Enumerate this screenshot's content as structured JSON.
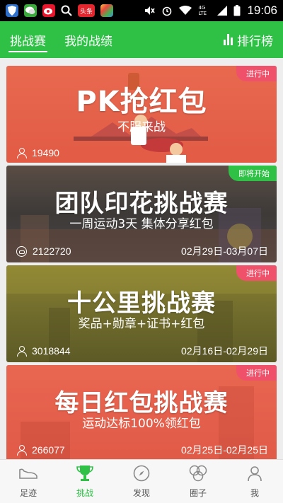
{
  "status_bar": {
    "time": "19:06",
    "network_label": "4G LTE",
    "notif_app_label": "头条",
    "icons": [
      "shield-app-icon",
      "wechat-icon",
      "weibo-icon",
      "search-icon",
      "toutiao-icon",
      "photos-icon",
      "mute-icon",
      "alarm-icon",
      "wifi-icon",
      "signal-icon",
      "battery-icon"
    ]
  },
  "header": {
    "tabs": [
      {
        "label": "挑战赛",
        "active": true
      },
      {
        "label": "我的战绩",
        "active": false
      }
    ],
    "rank_label": "排行榜",
    "accent_color": "#2ec146"
  },
  "cards": [
    {
      "title": "PK抢红包",
      "subtitle": "不服来战",
      "badge": "进行中",
      "count": "19490",
      "dates": "",
      "count_icon": "person-icon"
    },
    {
      "title": "团队印花挑战赛",
      "subtitle": "一周运动3天 集体分享红包",
      "badge": "即将开始",
      "count": "2122720",
      "dates": "02月29日-03月07日",
      "count_icon": "group-icon"
    },
    {
      "title": "十公里挑战赛",
      "subtitle": "奖品+勋章+证书+红包",
      "badge": "进行中",
      "count": "3018844",
      "dates": "02月16日-02月29日",
      "count_icon": "person-icon"
    },
    {
      "title": "每日红包挑战赛",
      "subtitle": "运动达标100%领红包",
      "badge": "进行中",
      "count": "266077",
      "dates": "02月25日-02月25日",
      "count_icon": "person-icon"
    }
  ],
  "badge_colors": {
    "进行中": "#f0516a",
    "即将开始": "#2ec146"
  },
  "bottom_nav": [
    {
      "label": "足迹",
      "icon": "shoe-icon",
      "active": false
    },
    {
      "label": "挑战",
      "icon": "trophy-icon",
      "active": true
    },
    {
      "label": "发现",
      "icon": "compass-icon",
      "active": false
    },
    {
      "label": "圈子",
      "icon": "circles-icon",
      "active": false
    },
    {
      "label": "我",
      "icon": "user-icon",
      "active": false
    }
  ]
}
